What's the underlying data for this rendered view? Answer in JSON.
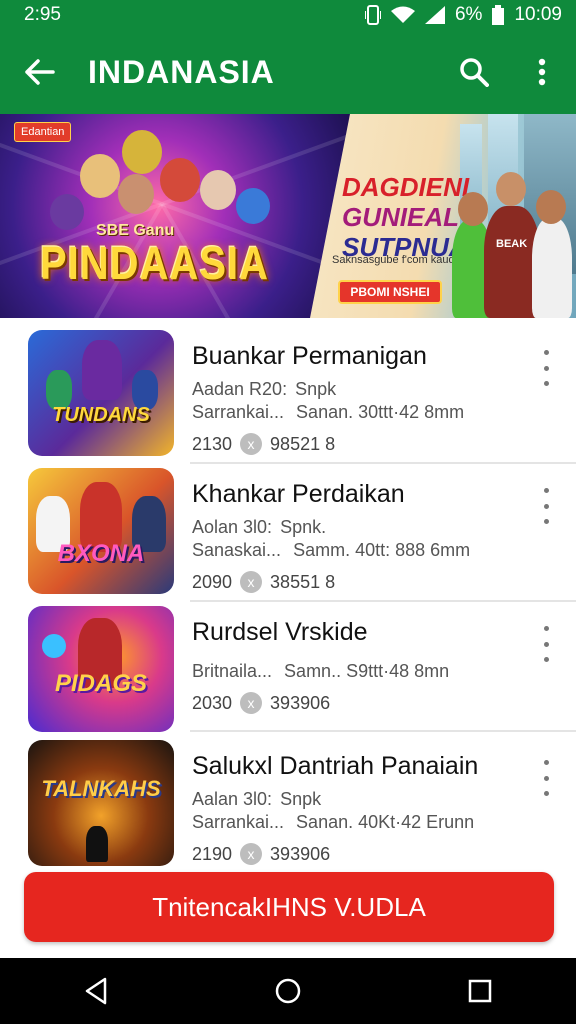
{
  "status_bar": {
    "left_text": "2:95",
    "battery_text": "6%",
    "time": "10:09"
  },
  "app_bar": {
    "title": "INDANASIA",
    "icons": [
      "back-arrow-icon",
      "search-icon",
      "more-vert-icon"
    ]
  },
  "banner": {
    "tag": "Edantian",
    "brand_small": "SBE Ganu",
    "brand_big": "PINDAASIA",
    "promo_lines": [
      "DAGDIENI",
      "GUNIEAL N",
      "SUTPNUA!"
    ],
    "promo_sub": "Saknsasgube f'com kaud",
    "promo_button": "PBOMI NSHEI",
    "shirt_text": "BEAK"
  },
  "items": [
    {
      "title": "Buankar Permanigan",
      "meta_a": "Aadan R20:",
      "meta_b": "Snpk",
      "meta_c": "Sarrankai...",
      "meta_d": "Sanan. 30ttt·42 8mm",
      "stat_1": "2130",
      "stat_2": "98521 8",
      "thumb_text": "TUNDANS",
      "thumb_colors": [
        "#2a6bd8",
        "#5b2a9a",
        "#f2b52a"
      ]
    },
    {
      "title": "Khankar Perdaikan",
      "meta_a": "Aolan 3l0:",
      "meta_b": "Spnk.",
      "meta_c": "Sanaskai...",
      "meta_d": "Samm. 40tt: 888 6mm",
      "stat_1": "2090",
      "stat_2": "38551 8",
      "thumb_text": "BXONA",
      "thumb_colors": [
        "#f6c93c",
        "#d9552a",
        "#2a3a7a"
      ]
    },
    {
      "title": "Rurdsel Vrskide",
      "meta_a": "",
      "meta_b": "",
      "meta_c": "Britnaila...",
      "meta_d": "Samn.. S9ttt·48 8mn",
      "stat_1": "2030",
      "stat_2": "393906",
      "thumb_text": "PIDAGS",
      "thumb_colors": [
        "#4a2bd0",
        "#d93a8a",
        "#ff9a2a"
      ]
    },
    {
      "title": "Salukxl Dantriah Panaiain",
      "meta_a": "Aalan 3l0:",
      "meta_b": "Snpk",
      "meta_c": "Sarrankai...",
      "meta_d": "Sanan. 40Kt·42 Erunn",
      "stat_1": "2190",
      "stat_2": "393906",
      "thumb_text": "TALNKAHS",
      "thumb_colors": [
        "#1a1410",
        "#8a3a10",
        "#f2a22a"
      ]
    }
  ],
  "cta": {
    "label": "TnitencakIHNS V.UDLA"
  },
  "nav_bar": {
    "icons": [
      "back-triangle-icon",
      "home-circle-icon",
      "recents-square-icon"
    ]
  },
  "colors": {
    "primary": "#0f8a3c",
    "cta": "#e6261f",
    "nav": "#000000"
  }
}
